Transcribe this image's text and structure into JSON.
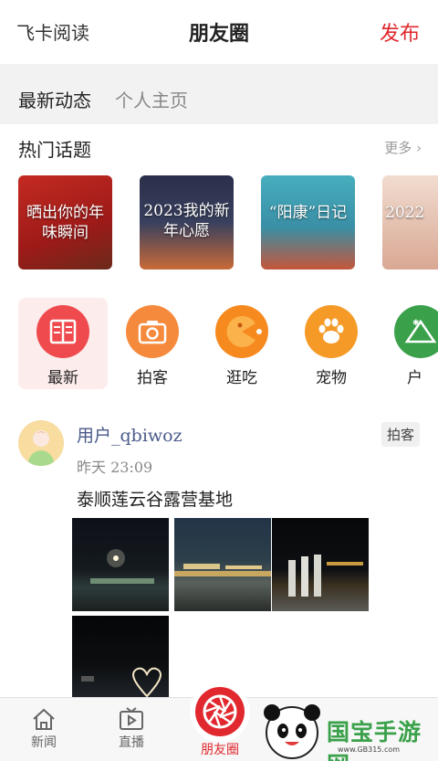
{
  "header": {
    "app_name": "飞卡阅读",
    "title": "朋友圈",
    "publish_label": "发布"
  },
  "subtabs": {
    "latest": "最新动态",
    "home": "个人主页"
  },
  "hot_topics": {
    "title": "热门话题",
    "more": "更多",
    "items": [
      {
        "text": "晒出你的年味瞬间",
        "color": "#b7201e"
      },
      {
        "text": "2023我的新年心愿",
        "color": "#2e3550"
      },
      {
        "text": "“阳康”日记",
        "color": "#3aa2b3"
      },
      {
        "text": "2022",
        "color": "#e7c6b4"
      }
    ]
  },
  "categories": [
    {
      "label": "最新",
      "icon": "book-icon",
      "color": "#ef4b4f"
    },
    {
      "label": "拍客",
      "icon": "camera-icon",
      "color": "#f68a3c"
    },
    {
      "label": "逛吃",
      "icon": "pacman-icon",
      "color": "#f68a1f"
    },
    {
      "label": "宠物",
      "icon": "paw-icon",
      "color": "#f59a26"
    },
    {
      "label": "户",
      "icon": "tent-icon",
      "color": "#3aa14a"
    }
  ],
  "post": {
    "username": "用户_qbiwoz",
    "time": "昨天 23:09",
    "tag": "拍客",
    "text": "泰顺莲云谷露营基地"
  },
  "tabbar": {
    "news": "新闻",
    "live": "直播",
    "moments": "朋友圈"
  },
  "watermark": {
    "brand": "国宝手游网",
    "url": "www.GB315.com"
  }
}
